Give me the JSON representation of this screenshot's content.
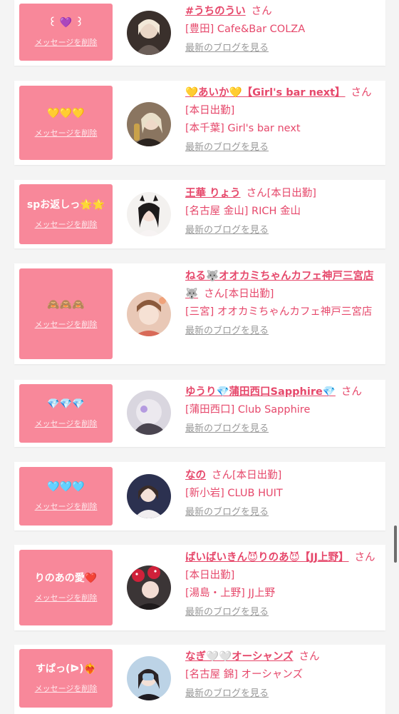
{
  "colors": {
    "accent": "#e6486b",
    "message_box": "#f8889a",
    "link_gray": "#999999",
    "background": "#f4f4f4"
  },
  "delete_label": "メッセージを削除",
  "blog_label": "最新のブログを見る",
  "san_label": "さん",
  "items": [
    {
      "message": "꒰ 💜 ꒱",
      "name": "#うちのうい",
      "status": "",
      "lines": [
        "[豊田] Cafe&Bar COLZA"
      ]
    },
    {
      "message": "💛💛💛",
      "name": "💛あいか💛【Girl's bar next】",
      "status": "",
      "lines": [
        "[本日出勤]",
        "[本千葉] Girl's bar next"
      ]
    },
    {
      "message": "spお返しっ🌟🌟",
      "name": "王華 りょう",
      "status": "[本日出勤]",
      "lines": [
        "[名古屋 金山] RICH 金山"
      ]
    },
    {
      "message": "🙈🙈🙈",
      "name": "ねる🐺オオカミちゃんカフェ神戸三宮店🐺",
      "status": "[本日出勤]",
      "lines": [
        "[三宮] オオカミちゃんカフェ神戸三宮店"
      ]
    },
    {
      "message": "💎💎💎",
      "name": "ゆうり💎蒲田西口Sapphire💎",
      "status": "",
      "lines": [
        "[蒲田西口] Club Sapphire"
      ]
    },
    {
      "message": "🩵🩵🩵",
      "name": "なの",
      "status": "[本日出勤]",
      "lines": [
        "[新小岩] CLUB HUIT"
      ]
    },
    {
      "message": "りのあの愛❤️",
      "name": "ばいばいきん😈りのあ😈【JJ上野】",
      "status": "[本日出勤]",
      "lines": [
        "[湯島・上野] JJ上野"
      ]
    },
    {
      "message": "すぱっ(ᐅ)❤️‍🔥",
      "name": "なぎ🤍🤍オーシャンズ",
      "status": "",
      "lines": [
        "[名古屋 錦] オーシャンズ"
      ]
    }
  ]
}
